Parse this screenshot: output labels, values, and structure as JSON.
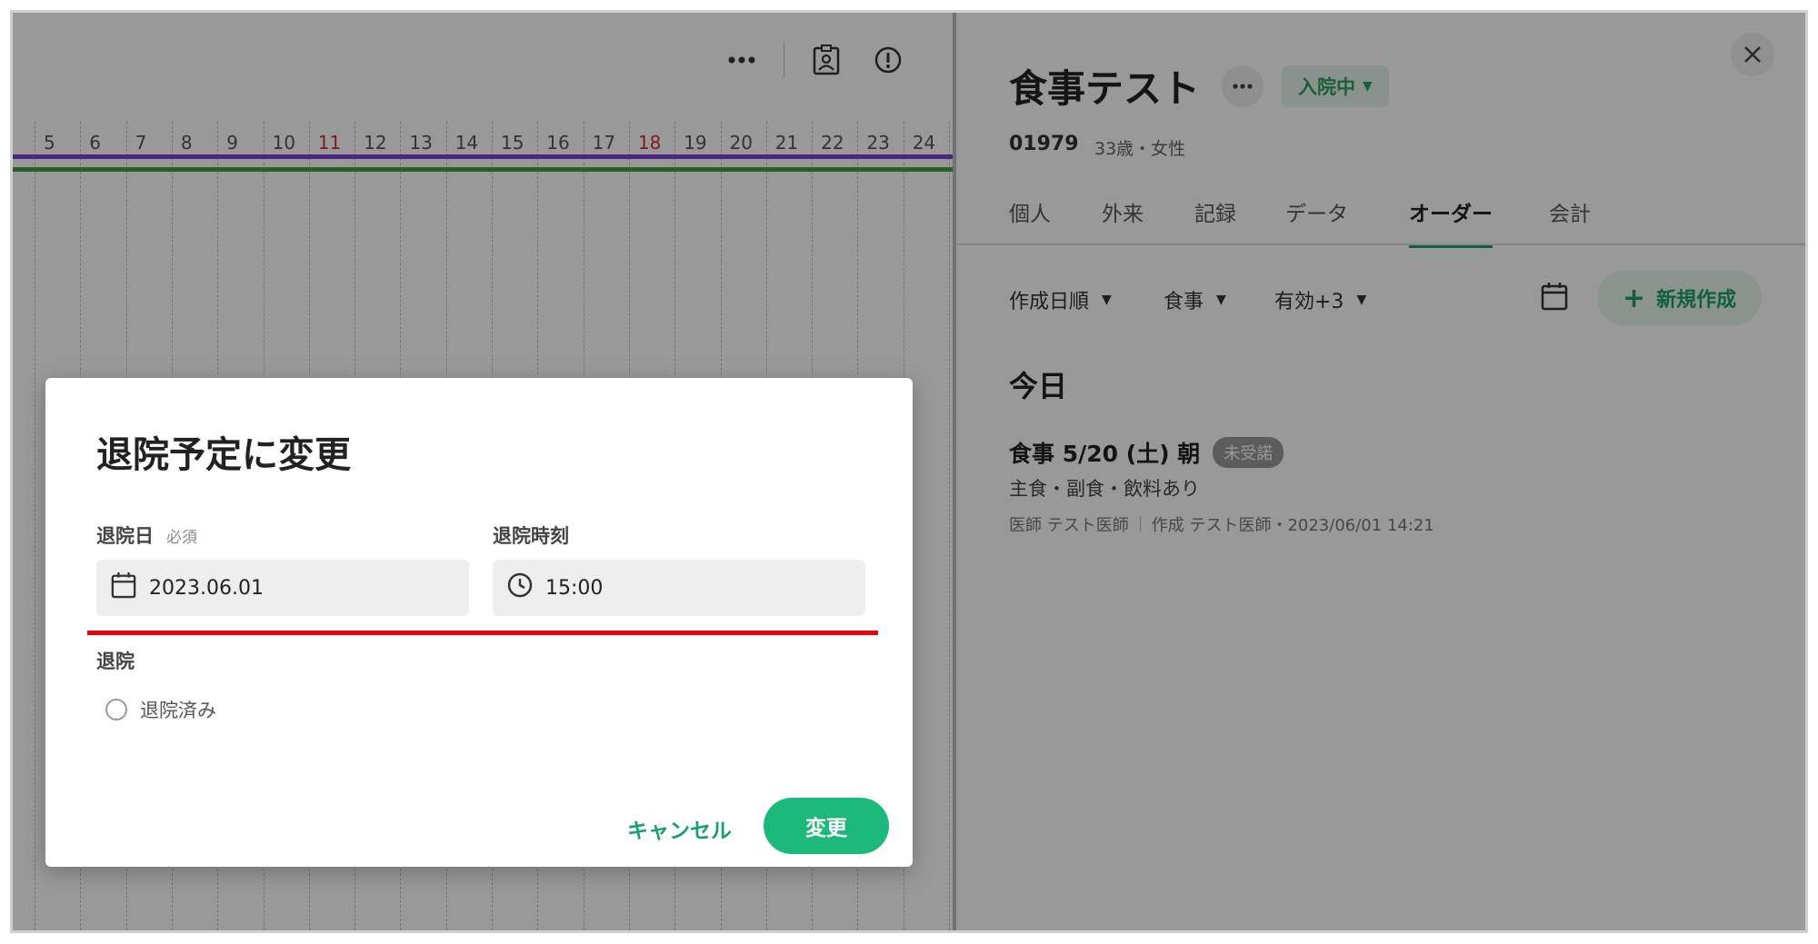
{
  "timeline": {
    "days": [
      "5",
      "6",
      "7",
      "8",
      "9",
      "10",
      "11",
      "12",
      "13",
      "14",
      "15",
      "16",
      "17",
      "18",
      "19",
      "20",
      "21",
      "22",
      "23",
      "24"
    ],
    "red_days": [
      "11",
      "18"
    ],
    "colors": {
      "purple_bar": "#7e3fd6",
      "green_bar": "#43a047"
    },
    "toolbar": {
      "more_icon": "…"
    }
  },
  "patient": {
    "name": "食事テスト",
    "status": "入院中",
    "id": "01979",
    "info": "33歳・女性"
  },
  "tabs": [
    "個人",
    "外来",
    "記録",
    "データ",
    "オーダー",
    "会計"
  ],
  "active_tab": "オーダー",
  "filters": {
    "sort": "作成日順",
    "type": "食事",
    "validity": "有効+3",
    "new_button": "新規作成"
  },
  "section_title": "今日",
  "order": {
    "title": "食事 5/20 (土) 朝",
    "badge": "未受諾",
    "subtitle": "主食・副食・飲料あり",
    "doctor": "医師 テスト医師",
    "created": "作成 テスト医師・2023/06/01 14:21"
  },
  "dialog": {
    "title": "退院予定に変更",
    "date_label": "退院日",
    "required": "必須",
    "date_value": "2023.06.01",
    "time_label": "退院時刻",
    "time_value": "15:00",
    "discharge_label": "退院",
    "discharged_option": "退院済み",
    "cancel": "キャンセル",
    "confirm": "変更"
  },
  "colors": {
    "accent": "#1db97a",
    "highlight_line": "#e8000b"
  }
}
